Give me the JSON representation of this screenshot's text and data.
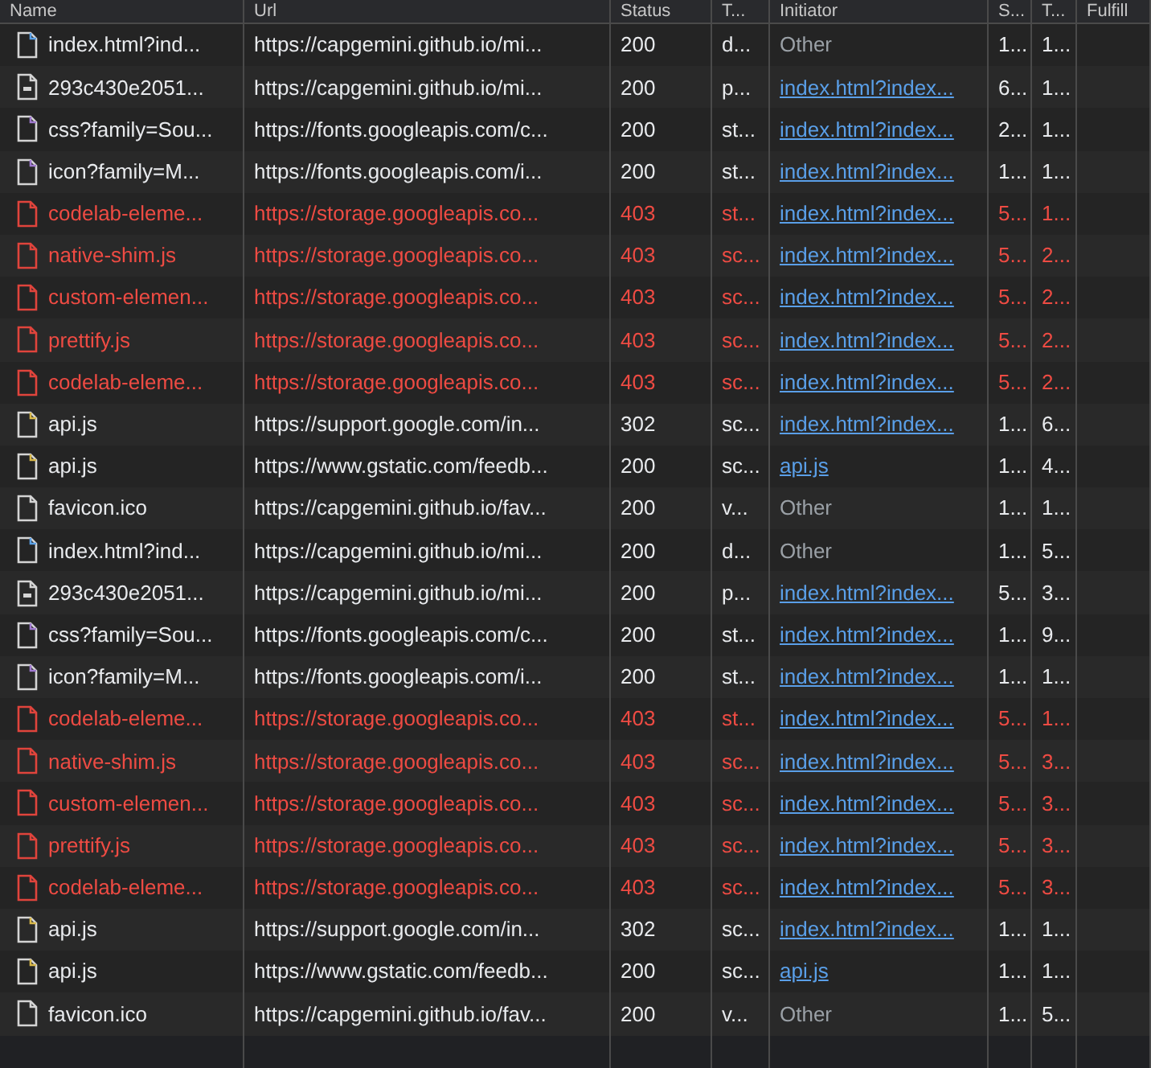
{
  "columns": [
    "Name",
    "Url",
    "Status",
    "T...",
    "Initiator",
    "S...",
    "T...",
    "Fulfill"
  ],
  "rows": [
    {
      "kind": "html",
      "name": "index.html?ind...",
      "url": "https://capgemini.github.io/mi...",
      "status": "200",
      "type": "d...",
      "initiator": {
        "text": "Other",
        "kind": "other"
      },
      "size": "1...",
      "time": "1...",
      "failed": false
    },
    {
      "kind": "fetch",
      "name": "293c430e2051...",
      "url": "https://capgemini.github.io/mi...",
      "status": "200",
      "type": "p...",
      "initiator": {
        "text": "index.html?index...",
        "kind": "link"
      },
      "size": "6...",
      "time": "1...",
      "failed": false
    },
    {
      "kind": "css",
      "name": "css?family=Sou...",
      "url": "https://fonts.googleapis.com/c...",
      "status": "200",
      "type": "st...",
      "initiator": {
        "text": "index.html?index...",
        "kind": "link"
      },
      "size": "2...",
      "time": "1...",
      "failed": false
    },
    {
      "kind": "css",
      "name": "icon?family=M...",
      "url": "https://fonts.googleapis.com/i...",
      "status": "200",
      "type": "st...",
      "initiator": {
        "text": "index.html?index...",
        "kind": "link"
      },
      "size": "1...",
      "time": "1...",
      "failed": false
    },
    {
      "kind": "plain",
      "name": "codelab-eleme...",
      "url": "https://storage.googleapis.co...",
      "status": "403",
      "type": "st...",
      "initiator": {
        "text": "index.html?index...",
        "kind": "link"
      },
      "size": "5...",
      "time": "1...",
      "failed": true
    },
    {
      "kind": "plain",
      "name": "native-shim.js",
      "url": "https://storage.googleapis.co...",
      "status": "403",
      "type": "sc...",
      "initiator": {
        "text": "index.html?index...",
        "kind": "link"
      },
      "size": "5...",
      "time": "2...",
      "failed": true
    },
    {
      "kind": "plain",
      "name": "custom-elemen...",
      "url": "https://storage.googleapis.co...",
      "status": "403",
      "type": "sc...",
      "initiator": {
        "text": "index.html?index...",
        "kind": "link"
      },
      "size": "5...",
      "time": "2...",
      "failed": true
    },
    {
      "kind": "plain",
      "name": "prettify.js",
      "url": "https://storage.googleapis.co...",
      "status": "403",
      "type": "sc...",
      "initiator": {
        "text": "index.html?index...",
        "kind": "link"
      },
      "size": "5...",
      "time": "2...",
      "failed": true
    },
    {
      "kind": "plain",
      "name": "codelab-eleme...",
      "url": "https://storage.googleapis.co...",
      "status": "403",
      "type": "sc...",
      "initiator": {
        "text": "index.html?index...",
        "kind": "link"
      },
      "size": "5...",
      "time": "2...",
      "failed": true
    },
    {
      "kind": "js",
      "name": "api.js",
      "url": "https://support.google.com/in...",
      "status": "302",
      "type": "sc...",
      "initiator": {
        "text": "index.html?index...",
        "kind": "link"
      },
      "size": "1...",
      "time": "6...",
      "failed": false
    },
    {
      "kind": "js",
      "name": "api.js",
      "url": "https://www.gstatic.com/feedb...",
      "status": "200",
      "type": "sc...",
      "initiator": {
        "text": "api.js",
        "kind": "link"
      },
      "size": "1...",
      "time": "4...",
      "failed": false
    },
    {
      "kind": "plain",
      "name": "favicon.ico",
      "url": "https://capgemini.github.io/fav...",
      "status": "200",
      "type": "v...",
      "initiator": {
        "text": "Other",
        "kind": "other"
      },
      "size": "1...",
      "time": "1...",
      "failed": false
    },
    {
      "kind": "html",
      "name": "index.html?ind...",
      "url": "https://capgemini.github.io/mi...",
      "status": "200",
      "type": "d...",
      "initiator": {
        "text": "Other",
        "kind": "other"
      },
      "size": "1...",
      "time": "5...",
      "failed": false
    },
    {
      "kind": "fetch",
      "name": "293c430e2051...",
      "url": "https://capgemini.github.io/mi...",
      "status": "200",
      "type": "p...",
      "initiator": {
        "text": "index.html?index...",
        "kind": "link"
      },
      "size": "5...",
      "time": "3...",
      "failed": false
    },
    {
      "kind": "css",
      "name": "css?family=Sou...",
      "url": "https://fonts.googleapis.com/c...",
      "status": "200",
      "type": "st...",
      "initiator": {
        "text": "index.html?index...",
        "kind": "link"
      },
      "size": "1...",
      "time": "9...",
      "failed": false
    },
    {
      "kind": "css",
      "name": "icon?family=M...",
      "url": "https://fonts.googleapis.com/i...",
      "status": "200",
      "type": "st...",
      "initiator": {
        "text": "index.html?index...",
        "kind": "link"
      },
      "size": "1...",
      "time": "1...",
      "failed": false
    },
    {
      "kind": "plain",
      "name": "codelab-eleme...",
      "url": "https://storage.googleapis.co...",
      "status": "403",
      "type": "st...",
      "initiator": {
        "text": "index.html?index...",
        "kind": "link"
      },
      "size": "5...",
      "time": "1...",
      "failed": true
    },
    {
      "kind": "plain",
      "name": "native-shim.js",
      "url": "https://storage.googleapis.co...",
      "status": "403",
      "type": "sc...",
      "initiator": {
        "text": "index.html?index...",
        "kind": "link"
      },
      "size": "5...",
      "time": "3...",
      "failed": true
    },
    {
      "kind": "plain",
      "name": "custom-elemen...",
      "url": "https://storage.googleapis.co...",
      "status": "403",
      "type": "sc...",
      "initiator": {
        "text": "index.html?index...",
        "kind": "link"
      },
      "size": "5...",
      "time": "3...",
      "failed": true
    },
    {
      "kind": "plain",
      "name": "prettify.js",
      "url": "https://storage.googleapis.co...",
      "status": "403",
      "type": "sc...",
      "initiator": {
        "text": "index.html?index...",
        "kind": "link"
      },
      "size": "5...",
      "time": "3...",
      "failed": true
    },
    {
      "kind": "plain",
      "name": "codelab-eleme...",
      "url": "https://storage.googleapis.co...",
      "status": "403",
      "type": "sc...",
      "initiator": {
        "text": "index.html?index...",
        "kind": "link"
      },
      "size": "5...",
      "time": "3...",
      "failed": true
    },
    {
      "kind": "js",
      "name": "api.js",
      "url": "https://support.google.com/in...",
      "status": "302",
      "type": "sc...",
      "initiator": {
        "text": "index.html?index...",
        "kind": "link"
      },
      "size": "1...",
      "time": "1...",
      "failed": false
    },
    {
      "kind": "js",
      "name": "api.js",
      "url": "https://www.gstatic.com/feedb...",
      "status": "200",
      "type": "sc...",
      "initiator": {
        "text": "api.js",
        "kind": "link"
      },
      "size": "1...",
      "time": "1...",
      "failed": false
    },
    {
      "kind": "plain",
      "name": "favicon.ico",
      "url": "https://capgemini.github.io/fav...",
      "status": "200",
      "type": "v...",
      "initiator": {
        "text": "Other",
        "kind": "other"
      },
      "size": "1...",
      "time": "5...",
      "failed": false
    }
  ]
}
